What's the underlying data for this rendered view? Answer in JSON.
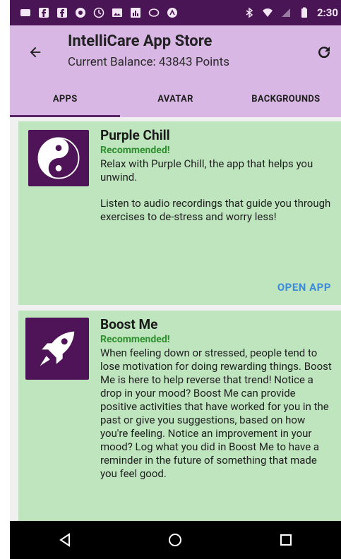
{
  "status_bar": {
    "time": "2:30",
    "left_icons": [
      "message-icon",
      "facebook-icon",
      "facebook-icon",
      "app-icon",
      "clock-icon",
      "gallery-icon",
      "chart-icon",
      "sync-icon",
      "location-icon"
    ],
    "right_icons": [
      "bluetooth-icon",
      "wifi-icon",
      "signal-icon",
      "battery-icon"
    ]
  },
  "header": {
    "title": "IntelliCare App Store",
    "subtitle": "Current Balance: 43843 Points",
    "back_icon": "arrow-back-icon",
    "refresh_icon": "refresh-icon"
  },
  "tabs": [
    {
      "label": "APPS",
      "active": true
    },
    {
      "label": "AVATAR",
      "active": false
    },
    {
      "label": "BACKGROUNDS",
      "active": false
    }
  ],
  "cards": [
    {
      "name": "Purple Chill",
      "badge": "Recommended!",
      "description_1": "Relax with Purple Chill, the app that helps you unwind.",
      "description_2": "Listen to audio recordings that guide you through exercises to de-stress and worry less!",
      "action": "OPEN APP",
      "icon": "yin-yang-icon"
    },
    {
      "name": "Boost Me",
      "badge": "Recommended!",
      "description_1": "When feeling down or stressed, people tend to lose motivation for doing rewarding things. Boost Me is here to help reverse that trend! Notice a drop in your mood? Boost Me can provide positive activities that have worked for you in the past or give you suggestions, based on how you're feeling. Notice an improvement in your mood? Log what you did in Boost Me to have a reminder in the future of something that made you feel good.",
      "icon": "rocket-icon"
    }
  ],
  "nav_bar": {
    "back_icon": "nav-back-icon",
    "home_icon": "nav-home-icon",
    "recents_icon": "nav-recents-icon"
  },
  "colors": {
    "status_bar": "#4a1554",
    "header": "#d9b7e4",
    "card_bg": "#bfe5bf",
    "tile": "#4f1357",
    "badge": "#2f8f2f",
    "action": "#3d8bd9"
  }
}
